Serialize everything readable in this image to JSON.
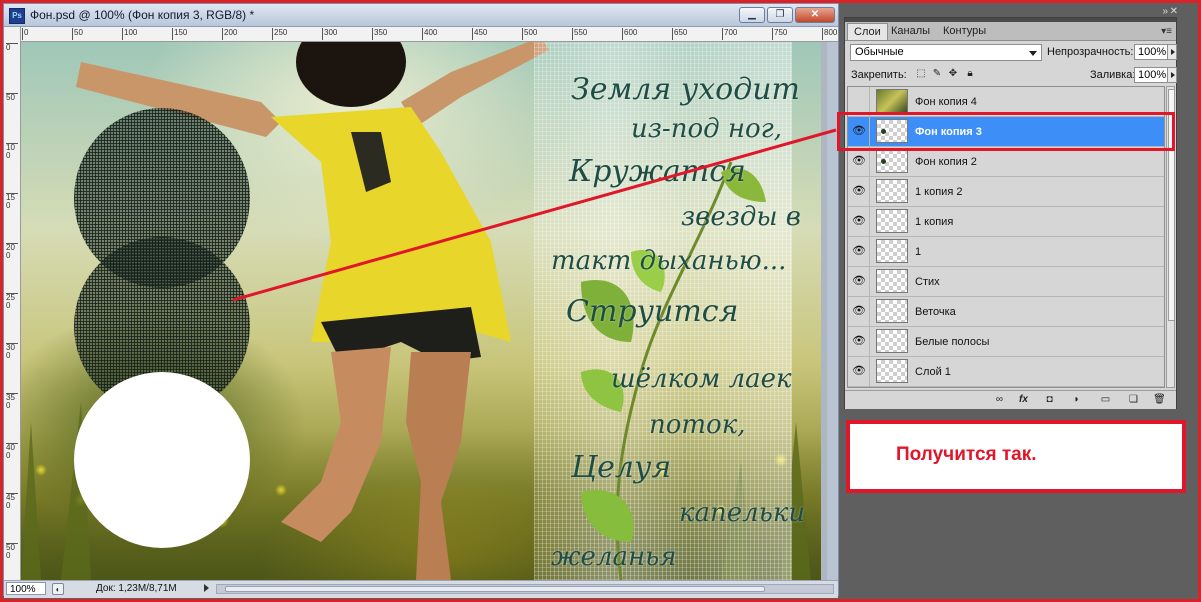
{
  "window": {
    "title": "Фон.psd @ 100% (Фон копия 3, RGB/8) *",
    "app_icon": "Ps",
    "controls": [
      "minimize",
      "restore",
      "close"
    ]
  },
  "ruler": {
    "top_ticks": [
      "0",
      "50",
      "100",
      "150",
      "200",
      "250",
      "300",
      "350",
      "400",
      "450",
      "500",
      "550",
      "600",
      "650",
      "700",
      "750",
      "800"
    ],
    "left_ticks": [
      "0",
      "50",
      "100",
      "150",
      "200",
      "250",
      "300",
      "350",
      "400",
      "450",
      "500"
    ]
  },
  "canvas": {
    "poem_lines": [
      "Земля уходит",
      "из-под ног,",
      "Кружатся",
      "звезды в",
      "такт дыханью...",
      "Струится",
      "шёлком лаек",
      "поток,",
      "Целуя",
      "капельки",
      "желанья"
    ]
  },
  "status": {
    "zoom": "100%",
    "doc_info": "Док: 1,23M/8,71M"
  },
  "panel": {
    "tabs": [
      "Слои",
      "Каналы",
      "Контуры"
    ],
    "active_tab": "Слои",
    "blend_mode": "Обычные",
    "opacity_label": "Непрозрачность:",
    "opacity_value": "100%",
    "lock_label": "Закрепить:",
    "fill_label": "Заливка:",
    "fill_value": "100%",
    "layers": [
      {
        "name": "Фон копия 4",
        "visible": false,
        "selected": false,
        "thumb": "photo"
      },
      {
        "name": "Фон копия 3",
        "visible": true,
        "selected": true,
        "thumb": "dot"
      },
      {
        "name": "Фон копия 2",
        "visible": true,
        "selected": false,
        "thumb": "dot"
      },
      {
        "name": "1 копия 2",
        "visible": true,
        "selected": false,
        "thumb": "checker"
      },
      {
        "name": "1 копия",
        "visible": true,
        "selected": false,
        "thumb": "checker"
      },
      {
        "name": "1",
        "visible": true,
        "selected": false,
        "thumb": "checker"
      },
      {
        "name": "Стих",
        "visible": true,
        "selected": false,
        "thumb": "checker"
      },
      {
        "name": "Веточка",
        "visible": true,
        "selected": false,
        "thumb": "checker"
      },
      {
        "name": "Белые полосы",
        "visible": true,
        "selected": false,
        "thumb": "checker"
      },
      {
        "name": "Слой 1",
        "visible": true,
        "selected": false,
        "thumb": "checker"
      }
    ],
    "bottom_icons": [
      "link-icon",
      "fx-icon",
      "mask-icon",
      "adjustment-icon",
      "group-folder-icon",
      "new-layer-icon",
      "trash-icon"
    ]
  },
  "callout": {
    "text": "Получится так."
  },
  "colors": {
    "annotation_red": "#e0162a",
    "selected_layer": "#3d8ef7"
  }
}
